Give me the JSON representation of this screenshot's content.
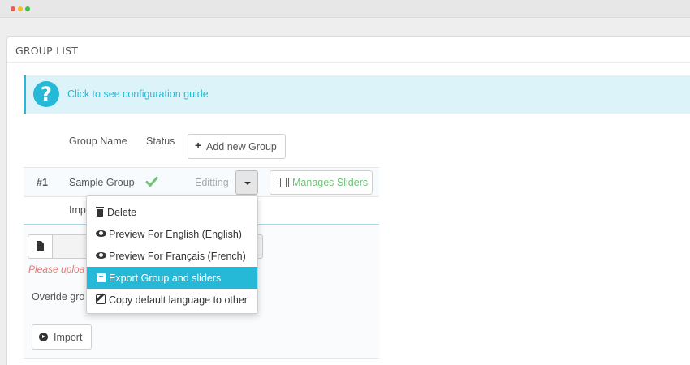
{
  "window": {
    "controls": [
      "close",
      "minimize",
      "maximize"
    ]
  },
  "panel": {
    "title": "GROUP LIST"
  },
  "guide": {
    "link_text": "Click to see configuration guide",
    "icon": "question-circle-icon",
    "accent": "#25b9d7",
    "background": "#dcf4f9"
  },
  "table": {
    "headers": {
      "group_name": "Group Name",
      "status": "Status"
    },
    "add_button_label": "Add new Group",
    "rows": [
      {
        "id": "#1",
        "name": "Sample Group",
        "status_icon": "check-icon",
        "action_label": "Editting",
        "manage_label": "Manages Sliders"
      }
    ],
    "row2_label": "Imp"
  },
  "import": {
    "upload_hint": "Please uploa",
    "override_label": "Overide gro",
    "import_button_label": "Import"
  },
  "dropdown": {
    "items": [
      {
        "label": "Delete",
        "icon": "trash-icon",
        "active": false
      },
      {
        "label": "Preview For English (English)",
        "icon": "eye-icon",
        "active": false
      },
      {
        "label": "Preview For Français (French)",
        "icon": "eye-icon",
        "active": false
      },
      {
        "label": "Export Group and sliders",
        "icon": "export-icon",
        "active": true
      },
      {
        "label": "Copy default language to other",
        "icon": "edit-icon",
        "active": false
      }
    ]
  },
  "colors": {
    "primary": "#25b9d7",
    "success": "#72c279",
    "danger_hint": "#e07b7b"
  }
}
